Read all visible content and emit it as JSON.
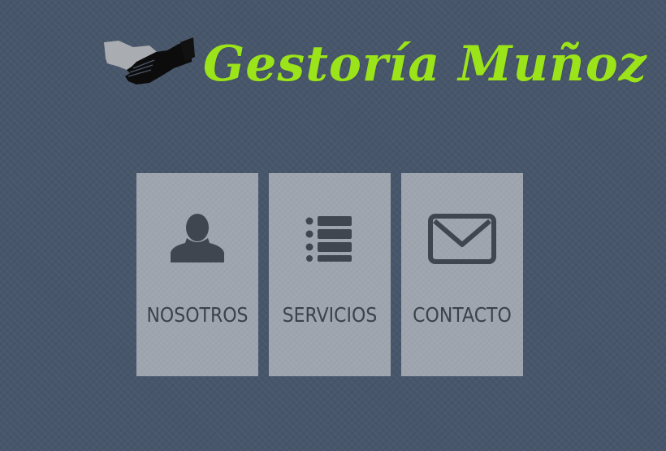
{
  "header": {
    "logo_icon": "handshake-icon",
    "brand_name": "Gestoría Muñoz"
  },
  "menu": {
    "items": [
      {
        "label": "NOSOTROS",
        "icon": "person-icon"
      },
      {
        "label": "SERVICIOS",
        "icon": "list-icon"
      },
      {
        "label": "CONTACTO",
        "icon": "envelope-icon"
      }
    ]
  },
  "colors": {
    "background": "#47566a",
    "brand": "#9be41a",
    "tile": "#9fa5ae",
    "tile_text": "#3b424c"
  }
}
